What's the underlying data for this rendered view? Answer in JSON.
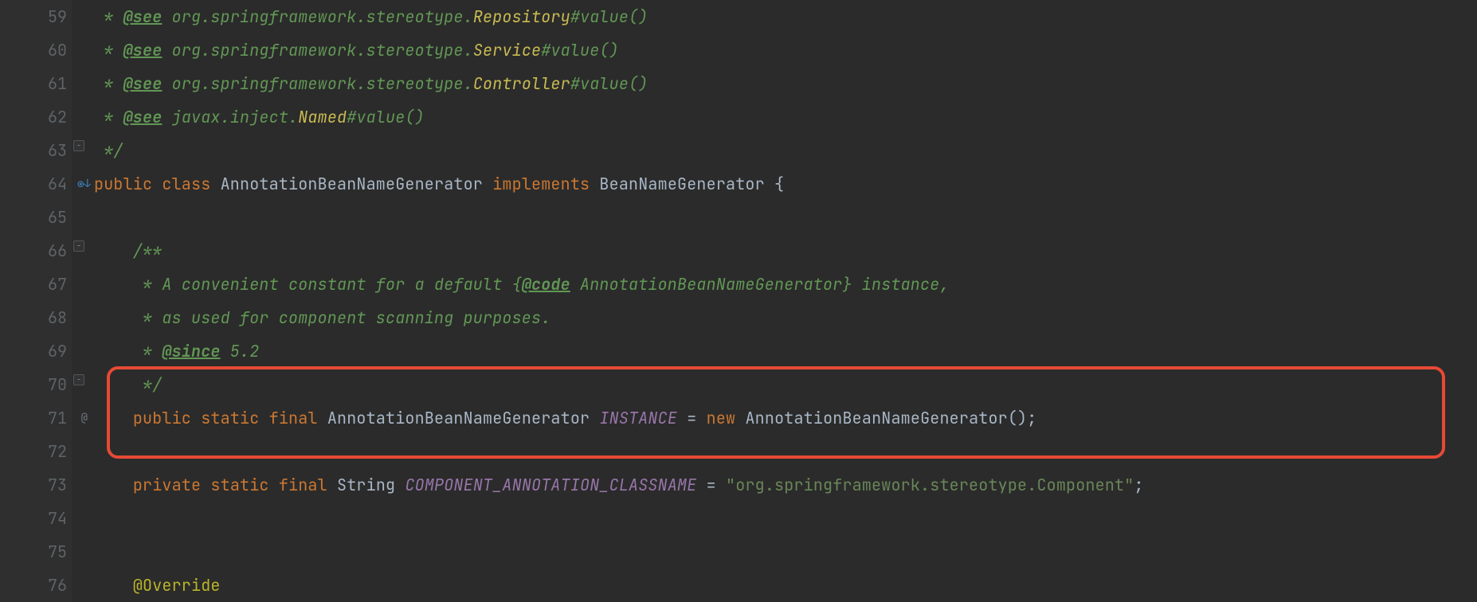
{
  "gutter": {
    "start": 59,
    "end": 76,
    "icons": {
      "64": "impl-circle",
      "71": "at"
    },
    "folds": {
      "63": "minus",
      "66": "minus",
      "70": "minus"
    }
  },
  "code": {
    "l59": {
      "prefix": " * ",
      "tag": "@see",
      "pkg": " org.springframework.stereotype.",
      "cls": "Repository",
      "suffix": "#value()"
    },
    "l60": {
      "prefix": " * ",
      "tag": "@see",
      "pkg": " org.springframework.stereotype.",
      "cls": "Service",
      "suffix": "#value()"
    },
    "l61": {
      "prefix": " * ",
      "tag": "@see",
      "pkg": " org.springframework.stereotype.",
      "cls": "Controller",
      "suffix": "#value()"
    },
    "l62": {
      "prefix": " * ",
      "tag": "@see",
      "pkg": " javax.inject.",
      "cls": "Named",
      "suffix": "#value()"
    },
    "l63": {
      "text": " */"
    },
    "l64": {
      "kw1": "public ",
      "kw2": "class ",
      "name": "AnnotationBeanNameGenerator ",
      "kw3": "implements ",
      "iface": "BeanNameGenerator ",
      "brace": "{"
    },
    "l65": {
      "text": ""
    },
    "l66": {
      "text": "    /**"
    },
    "l67": {
      "pre": "     * A convenient constant for a default {",
      "tag": "@code",
      "mid": " AnnotationBeanNameGenerator} instance,"
    },
    "l68": {
      "text": "     * as used for component scanning purposes."
    },
    "l69": {
      "pre": "     * ",
      "tag": "@since",
      "post": " 5.2"
    },
    "l70": {
      "text": "     */"
    },
    "l71": {
      "indent": "    ",
      "kw1": "public ",
      "kw2": "static ",
      "kw3": "final ",
      "type": "AnnotationBeanNameGenerator ",
      "name": "INSTANCE",
      "eq": " = ",
      "kw4": "new ",
      "ctor": "AnnotationBeanNameGenerator()",
      "semi": ";"
    },
    "l72": {
      "text": ""
    },
    "l73": {
      "indent": "    ",
      "kw1": "private ",
      "kw2": "static ",
      "kw3": "final ",
      "type": "String ",
      "name": "COMPONENT_ANNOTATION_CLASSNAME",
      "eq": " = ",
      "str": "\"org.springframework.stereotype.Component\"",
      "semi": ";"
    },
    "l74": {
      "text": ""
    },
    "l75": {
      "text": ""
    },
    "l76": {
      "indent": "    ",
      "ann": "@Override"
    }
  },
  "highlight": {
    "top_line": 70,
    "height_lines": 3
  }
}
